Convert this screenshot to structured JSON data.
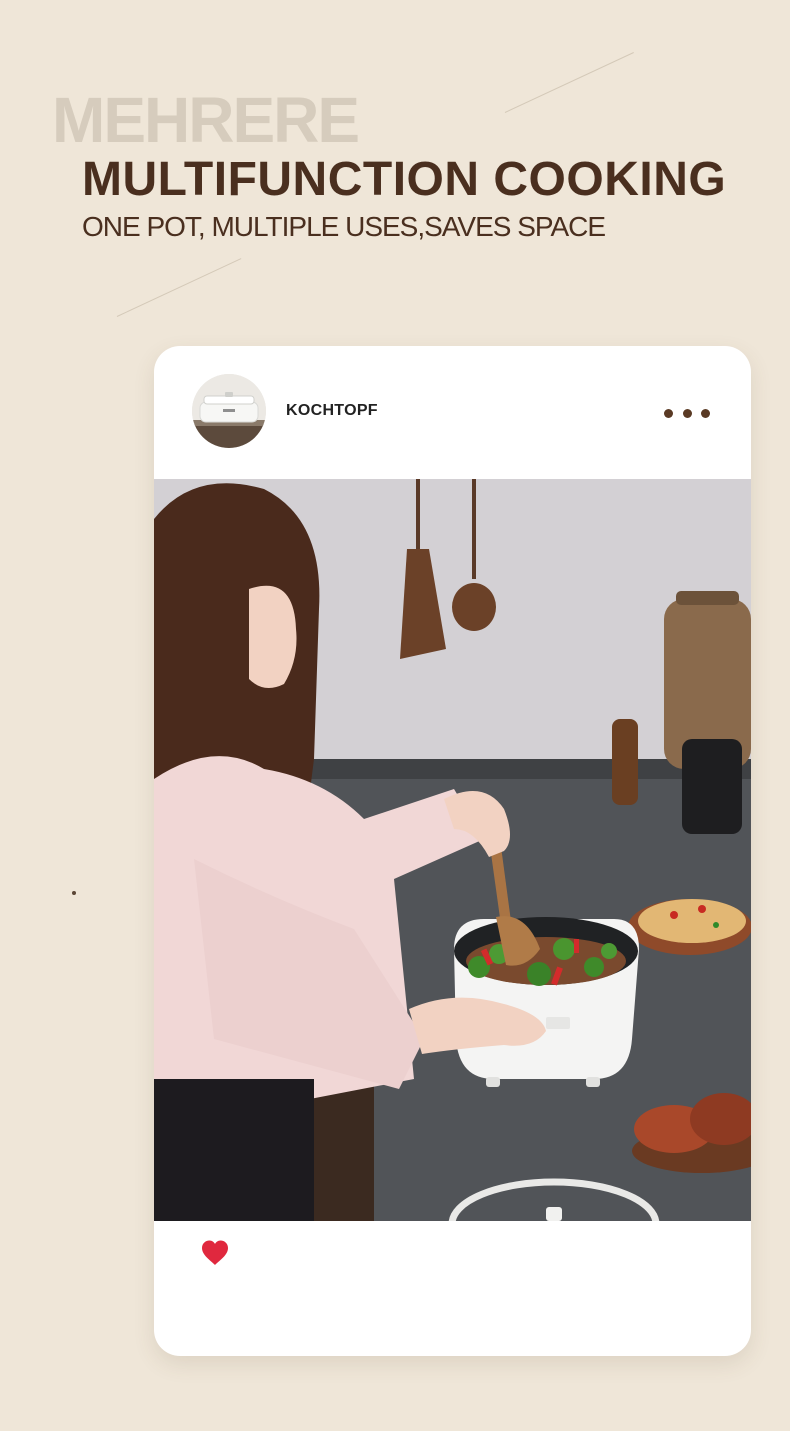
{
  "header": {
    "brand": "MEHRERE",
    "title": "MULTIFUNCTION COOKING",
    "subtitle": "ONE POT, MULTIPLE USES,SAVES SPACE"
  },
  "post": {
    "username": "KOCHTOPF",
    "avatar_icon": "cooking-pot-thumbnail",
    "menu_icon": "more-dots-icon",
    "like_icon": "heart-icon",
    "like_color": "#e0283e"
  },
  "colors": {
    "background": "#efe6d8",
    "title": "#4a2f1f",
    "brand_ghost": "#d6ccbd",
    "card": "#ffffff"
  }
}
